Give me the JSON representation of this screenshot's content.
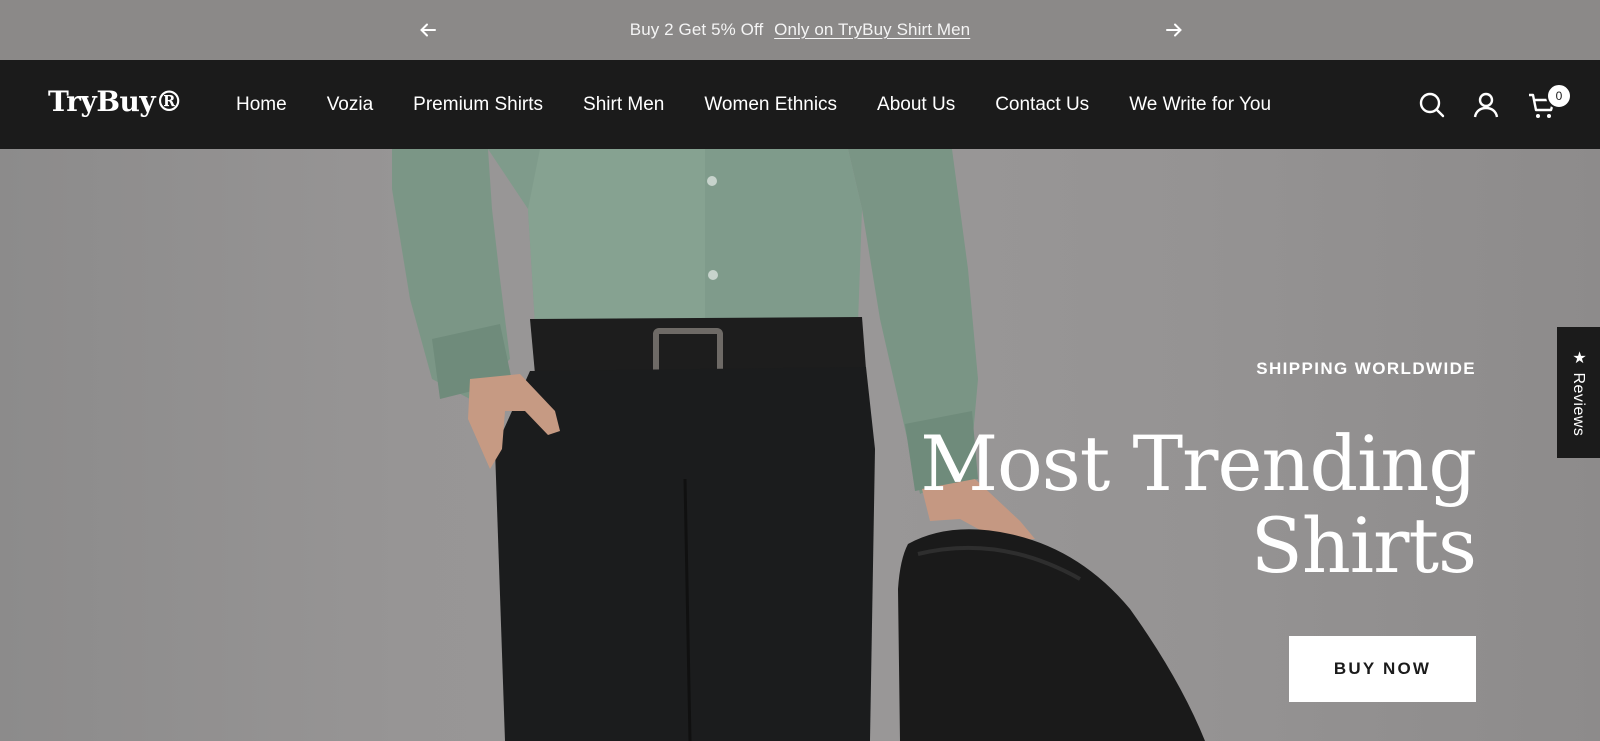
{
  "announcement": {
    "text": "Buy 2 Get 5% Off",
    "link": "Only on TryBuy Shirt Men",
    "prev_icon": "arrow-left-icon",
    "next_icon": "arrow-right-icon"
  },
  "header": {
    "logo": "TryBuy®",
    "nav": [
      "Home",
      "Vozia",
      "Premium Shirts",
      "Shirt Men",
      "Women Ethnics",
      "About Us",
      "Contact Us",
      "We Write for You"
    ],
    "icons": [
      "search-icon",
      "account-icon",
      "cart-icon"
    ],
    "cart_count": "0"
  },
  "hero": {
    "eyebrow": "SHIPPING WORLDWIDE",
    "headline_line1": "Most Trending",
    "headline_line2": "Shirts",
    "cta": "BUY NOW"
  },
  "reviews_tab": {
    "label": "★ Reviews"
  },
  "colors": {
    "header_bg": "#1b1b1b",
    "announcement_bg": "#8b8988",
    "hero_bg": "#979595",
    "shirt": "#7a9888"
  }
}
